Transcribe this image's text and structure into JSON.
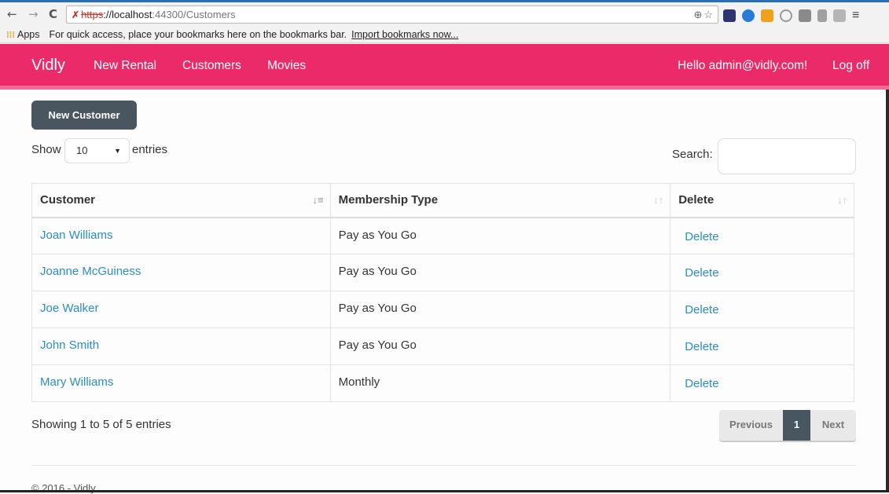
{
  "browser": {
    "url_proto": "https",
    "url_host": "://localhost",
    "url_path": ":44300/Customers",
    "icons": [
      "back-icon",
      "forward-icon",
      "reload-icon",
      "zoom-icon",
      "star-icon",
      "menu-icon"
    ],
    "bookmarks": {
      "apps_label": "Apps",
      "hint": "For quick access, place your bookmarks here on the bookmarks bar.",
      "import_link": "Import bookmarks now..."
    }
  },
  "navbar": {
    "brand": "Vidly",
    "links": [
      "New Rental",
      "Customers",
      "Movies"
    ],
    "greeting": "Hello admin@vidly.com!",
    "logoff": "Log off",
    "color": "#eb2a6a"
  },
  "toolbar": {
    "new_customer": "New Customer",
    "show_label": "Show",
    "entries_label": "entries",
    "page_length": "10",
    "search_label": "Search:"
  },
  "table": {
    "headers": [
      "Customer",
      "Membership Type",
      "Delete"
    ],
    "rows": [
      {
        "customer": "Joan Williams",
        "membership": "Pay as You Go",
        "action": "Delete"
      },
      {
        "customer": "Joanne McGuiness",
        "membership": "Pay as You Go",
        "action": "Delete"
      },
      {
        "customer": "Joe Walker",
        "membership": "Pay as You Go",
        "action": "Delete"
      },
      {
        "customer": "John Smith",
        "membership": "Pay as You Go",
        "action": "Delete"
      },
      {
        "customer": "Mary Williams",
        "membership": "Monthly",
        "action": "Delete"
      }
    ]
  },
  "footer": {
    "info": "Showing 1 to 5 of 5 entries",
    "prev": "Previous",
    "page": "1",
    "next": "Next",
    "copyright": "© 2016 - Vidly"
  }
}
